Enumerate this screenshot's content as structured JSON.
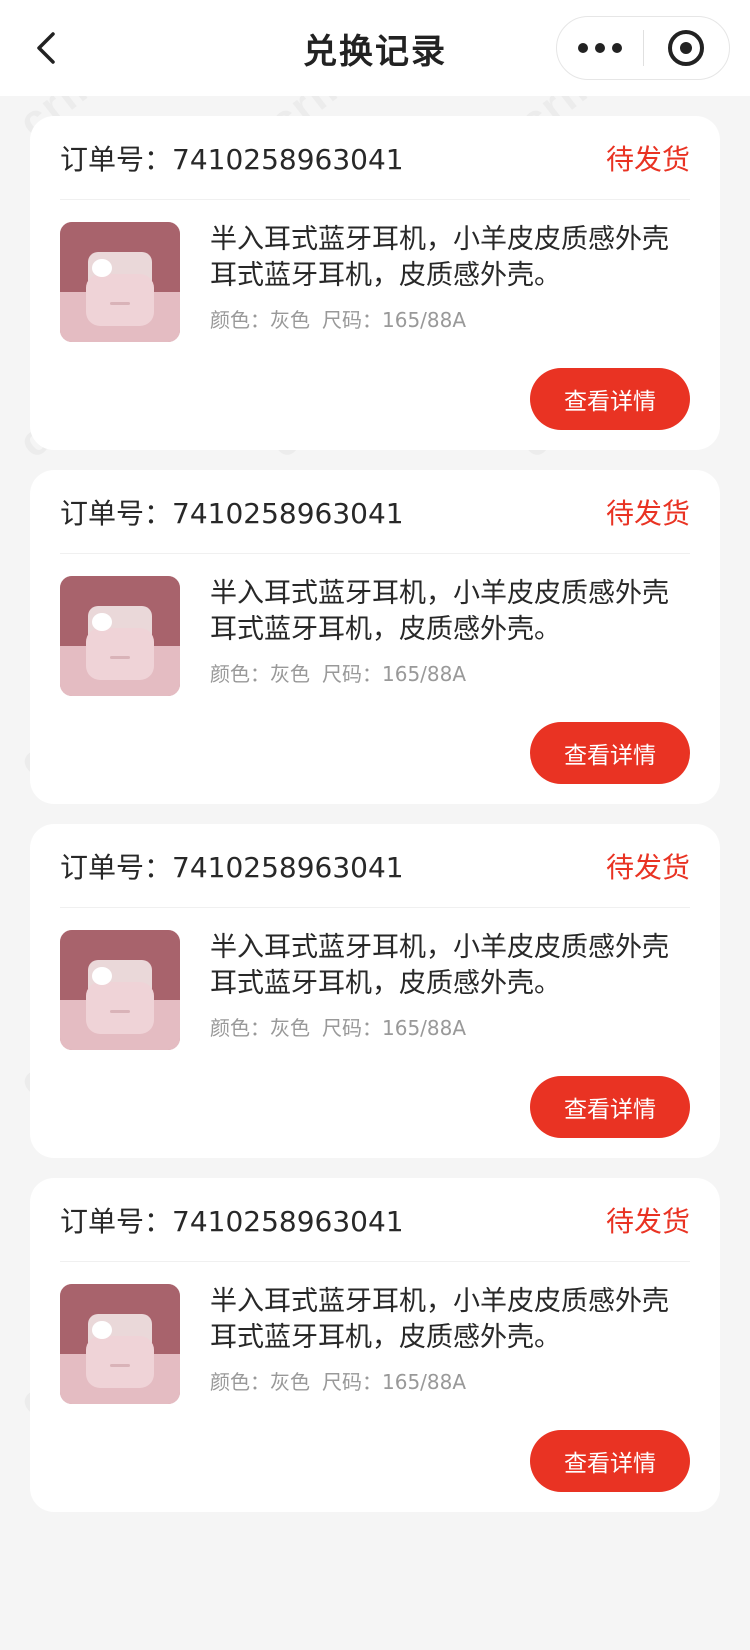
{
  "navbar": {
    "title": "兑换记录",
    "back_icon": "chevron-left-icon",
    "more_icon": "more-dots-icon",
    "close_icon": "target-close-icon"
  },
  "watermark": "crmeb",
  "colors": {
    "accent": "#e93323",
    "background": "#f5f5f5",
    "card": "#ffffff"
  },
  "orders": [
    {
      "order_label": "订单号：",
      "order_no": "7410258963041",
      "status": "待发货",
      "product_name": "半入耳式蓝牙耳机，小羊皮皮质感外壳耳式蓝牙耳机，皮质感外壳。",
      "color_label": "颜色：灰色",
      "size_label": "尺码：165/88A",
      "button": "查看详情"
    },
    {
      "order_label": "订单号：",
      "order_no": "7410258963041",
      "status": "待发货",
      "product_name": "半入耳式蓝牙耳机，小羊皮皮质感外壳耳式蓝牙耳机，皮质感外壳。",
      "color_label": "颜色：灰色",
      "size_label": "尺码：165/88A",
      "button": "查看详情"
    },
    {
      "order_label": "订单号：",
      "order_no": "7410258963041",
      "status": "待发货",
      "product_name": "半入耳式蓝牙耳机，小羊皮皮质感外壳耳式蓝牙耳机，皮质感外壳。",
      "color_label": "颜色：灰色",
      "size_label": "尺码：165/88A",
      "button": "查看详情"
    },
    {
      "order_label": "订单号：",
      "order_no": "7410258963041",
      "status": "待发货",
      "product_name": "半入耳式蓝牙耳机，小羊皮皮质感外壳耳式蓝牙耳机，皮质感外壳。",
      "color_label": "颜色：灰色",
      "size_label": "尺码：165/88A",
      "button": "查看详情"
    }
  ]
}
